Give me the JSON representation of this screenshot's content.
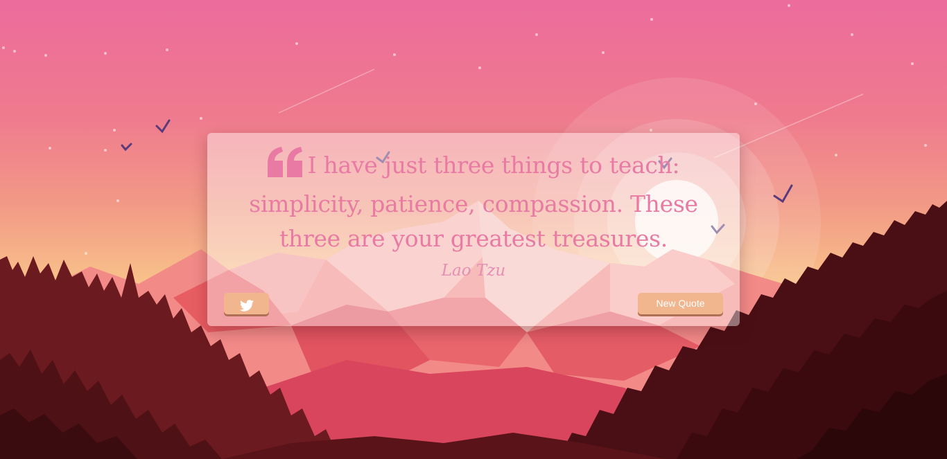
{
  "quote": {
    "text": "I have just three things to teach: simplicity, patience, compassion. These three are your greatest treasures.",
    "author": "Lao Tzu"
  },
  "buttons": {
    "tweet_icon": "twitter-icon",
    "new_quote_label": "New Quote"
  },
  "colors": {
    "quote_text": "#e97aa3",
    "author_text": "#e58fb4",
    "button_bg": "#f2b68f",
    "sky_top": "#ec6c9c",
    "sky_bottom": "#fbd28a",
    "forest_dark": "#4a0f14"
  }
}
